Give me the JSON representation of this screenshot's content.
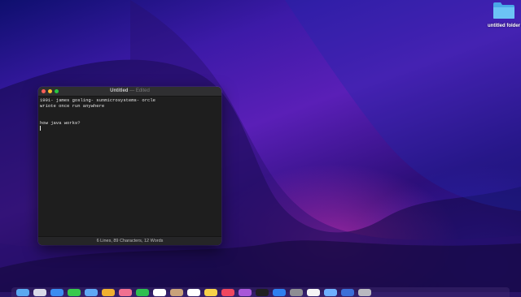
{
  "desktop": {
    "folder_label": "untitled folder",
    "folder_color": "#6cc3f5"
  },
  "window": {
    "title": "Untitled",
    "title_separator": "—",
    "title_state": "Edited",
    "lines": [
      "1991- james gosling- sunmicrosystems- orcle",
      "wriote once run anywhere",
      "",
      "",
      "how java works?",
      ""
    ],
    "status": "6 Lines, 89 Characters, 12 Words"
  },
  "dock": {
    "icons": [
      "finder-icon",
      "launchpad-icon",
      "safari-icon",
      "messages-icon",
      "mail-icon",
      "maps-icon",
      "photos-icon",
      "facetime-icon",
      "calendar-icon",
      "contacts-icon",
      "reminders-icon",
      "notes-icon",
      "music-icon",
      "podcasts-icon",
      "tv-icon",
      "appstore-icon",
      "settings-icon",
      "textedit-icon",
      "preview-icon",
      "downloads-icon",
      "trash-icon"
    ],
    "colors": [
      "#5aa9f0",
      "#d9d9e8",
      "#3b8cf0",
      "#38c94c",
      "#5fa8f5",
      "#f0b030",
      "#f07090",
      "#2fbf4f",
      "#ffffff",
      "#c9a27a",
      "#ffffff",
      "#f6d24a",
      "#f0475e",
      "#a857d8",
      "#202020",
      "#2f7ff0",
      "#8e8e93",
      "#f5f5f5",
      "#6fb0ff",
      "#3c6fd8",
      "#b9b9c0"
    ]
  }
}
